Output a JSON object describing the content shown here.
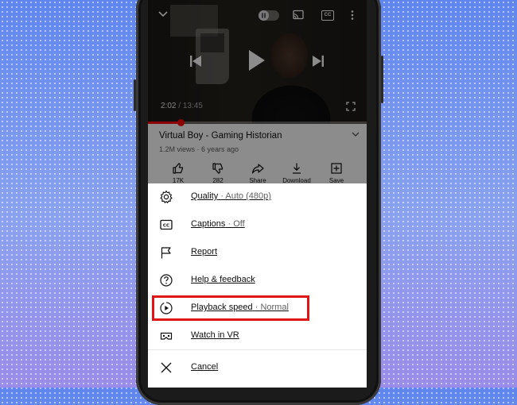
{
  "video": {
    "current_time": "2:02",
    "separator": " / ",
    "duration": "13:45",
    "progress_fraction": 0.148,
    "title": "Virtual Boy - Gaming Historian",
    "views": "1.2M views",
    "dot": " · ",
    "age": "6 years ago",
    "captions_badge": "CC"
  },
  "actions": [
    {
      "label": "17K",
      "icon": "thumbs-up-icon"
    },
    {
      "label": "282",
      "icon": "thumbs-down-icon"
    },
    {
      "label": "Share",
      "icon": "share-icon"
    },
    {
      "label": "Download",
      "icon": "download-icon"
    },
    {
      "label": "Save",
      "icon": "save-icon"
    }
  ],
  "menu": {
    "quality": {
      "label": "Quality",
      "value": "· Auto (480p)"
    },
    "captions": {
      "label": "Captions",
      "value": "· Off"
    },
    "report": {
      "label": "Report"
    },
    "help": {
      "label": "Help & feedback"
    },
    "playback_speed": {
      "label": "Playback speed",
      "value": "· Normal"
    },
    "watch_vr": {
      "label": "Watch in VR"
    },
    "cancel": {
      "label": "Cancel"
    }
  },
  "colors": {
    "highlight": "#e11515",
    "progress": "#ff0000"
  }
}
